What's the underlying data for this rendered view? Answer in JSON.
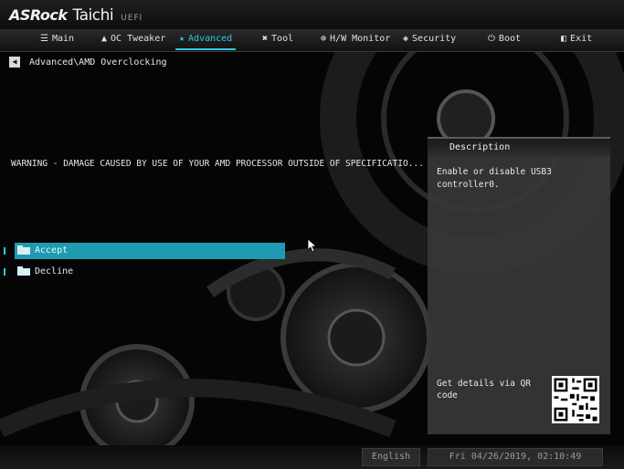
{
  "brand": {
    "vendor": "ASRock",
    "model": "Taichi",
    "firmware": "UEFI"
  },
  "menu": {
    "items": [
      {
        "label": "Main",
        "icon": "list-icon"
      },
      {
        "label": "OC Tweaker",
        "icon": "flame-icon"
      },
      {
        "label": "Advanced",
        "icon": "star-icon",
        "active": true
      },
      {
        "label": "Tool",
        "icon": "tools-icon"
      },
      {
        "label": "H/W Monitor",
        "icon": "monitor-icon"
      },
      {
        "label": "Security",
        "icon": "shield-icon"
      },
      {
        "label": "Boot",
        "icon": "power-icon"
      },
      {
        "label": "Exit",
        "icon": "exit-icon"
      }
    ]
  },
  "breadcrumb": {
    "path": "Advanced\\AMD Overclocking"
  },
  "warning": {
    "text": "WARNING - DAMAGE CAUSED BY USE OF YOUR AMD PROCESSOR OUTSIDE OF SPECIFICATIO..."
  },
  "options": [
    {
      "label": "Accept",
      "selected": true
    },
    {
      "label": "Decline",
      "selected": false
    }
  ],
  "description": {
    "header": "Description",
    "text": "Enable or disable USB3 controller0.",
    "qr_label": "Get details via QR code"
  },
  "status": {
    "language": "English",
    "datetime": "Fri 04/26/2019, 02:10:49"
  },
  "colors": {
    "accent": "#2ec7e0",
    "selected_bg": "#1e9bb0",
    "panel_bg": "#373737",
    "background": "#050505"
  }
}
